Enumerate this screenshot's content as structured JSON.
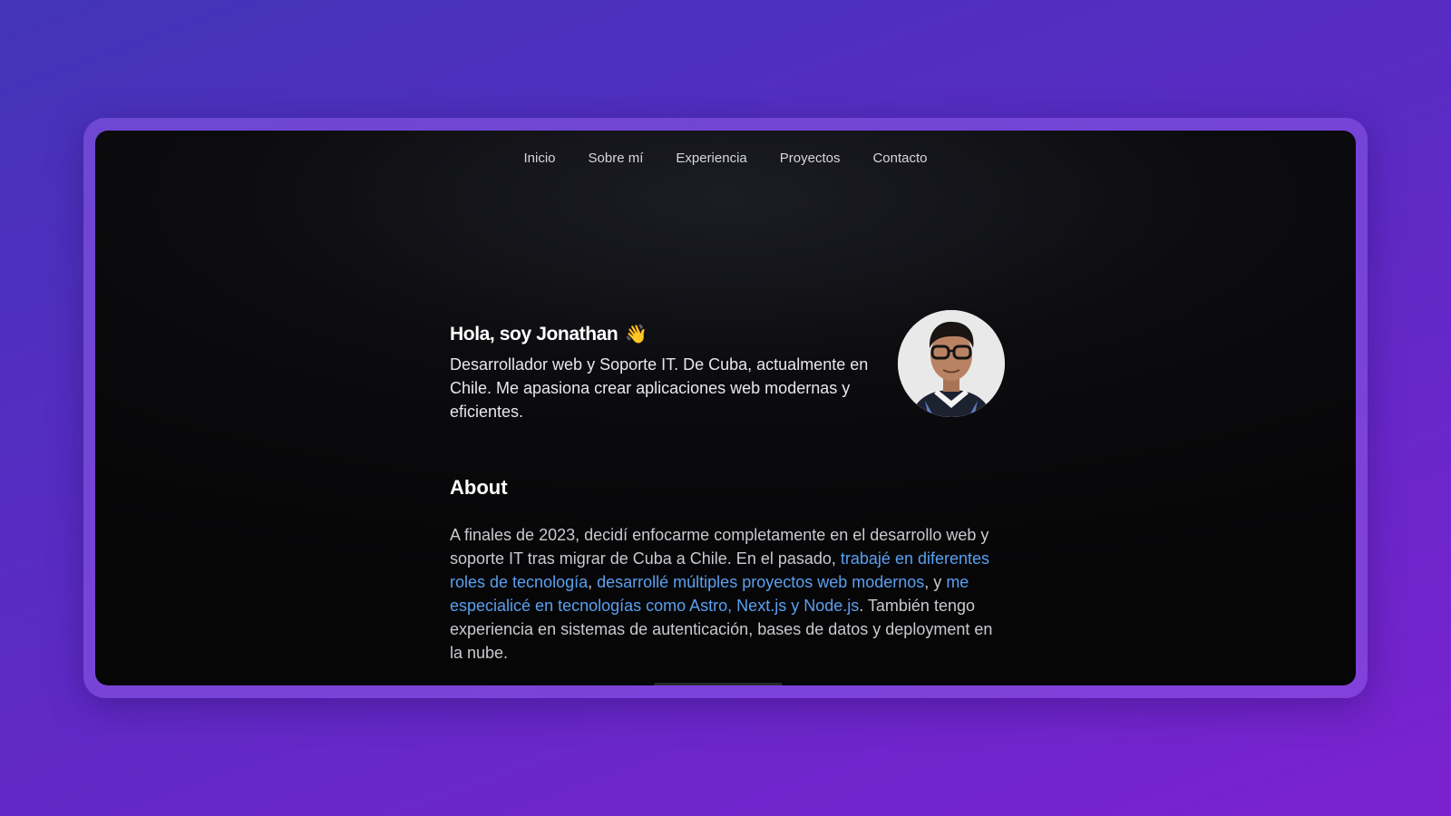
{
  "nav": {
    "items": [
      {
        "label": "Inicio"
      },
      {
        "label": "Sobre mí"
      },
      {
        "label": "Experiencia"
      },
      {
        "label": "Proyectos"
      },
      {
        "label": "Contacto"
      }
    ]
  },
  "hero": {
    "title": "Hola, soy Jonathan",
    "emoji": "👋",
    "description": "Desarrollador web y Soporte IT. De Cuba, actualmente en Chile. Me apasiona crear aplicaciones web modernas y eficientes."
  },
  "about": {
    "title": "About",
    "segments": {
      "s1": "A finales de 2023, decidí enfocarme completamente en el desarrollo web y soporte IT tras migrar de Cuba a Chile. En el pasado, ",
      "link1": "trabajé en diferentes roles de tecnología",
      "s2": ", ",
      "link2": "desarrollé múltiples proyectos web modernos",
      "s3": ", y ",
      "link3": "me especialicé en tecnologías como Astro, Next.js y Node.js",
      "s4": ". También tengo experiencia en sistemas de autenticación, bases de datos y deployment en la nube."
    }
  },
  "colors": {
    "link": "#5aa0f0",
    "background_gradient_start": "#4334b8",
    "background_gradient_end": "#7b22cf"
  }
}
